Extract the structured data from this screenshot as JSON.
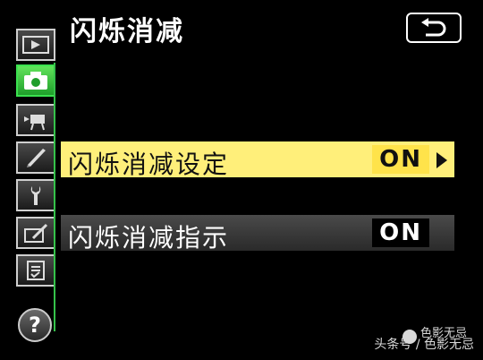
{
  "header": {
    "title": "闪烁消减"
  },
  "menu": {
    "rows": [
      {
        "label": "闪烁消减设定",
        "value": "ON"
      },
      {
        "label": "闪烁消减指示",
        "value": "ON"
      }
    ]
  },
  "watermark": {
    "brand": "色影无忌",
    "source": "头条号 / 色影无忌"
  },
  "colors": {
    "accent": "#3be24f",
    "highlight": "#ffef7a"
  },
  "icons": [
    "playback-icon",
    "camera-icon",
    "movie-icon",
    "pencil-icon",
    "wrench-icon",
    "retouch-icon",
    "mymenu-icon",
    "help-icon",
    "back-icon"
  ]
}
